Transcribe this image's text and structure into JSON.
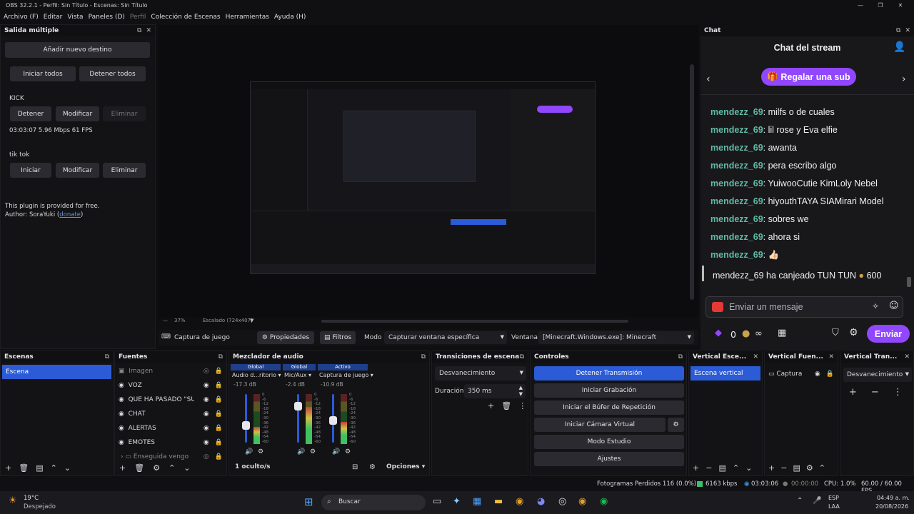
{
  "window": {
    "title": "OBS 32.2.1 - Perfil: Sin Título - Escenas: Sin Título"
  },
  "menu": [
    "Archivo (F)",
    "Editar",
    "Vista",
    "Paneles (D)",
    "Perfil",
    "Colección de Escenas",
    "Herramientas",
    "Ayuda (H)"
  ],
  "multi": {
    "title": "Salida múltiple",
    "add": "Añadir nuevo destino",
    "start_all": "Iniciar todos",
    "stop_all": "Detener todos",
    "kick": {
      "name": "KICK",
      "stop": "Detener",
      "edit": "Modificar",
      "del": "Eliminar",
      "stats": "03:03:07  5.96 Mbps  61 FPS"
    },
    "tiktok": {
      "name": "tik tok",
      "start": "Iniciar",
      "edit": "Modificar",
      "del": "Eliminar"
    },
    "plugin": "This plugin is provided for free.",
    "author_prefix": "Author: SoraYuki (",
    "donate": "donate",
    "author_suffix": ")"
  },
  "preview": {
    "zoom": "37%",
    "scaled": "Escalado (724x407)"
  },
  "ctxbar": {
    "source": "Captura de juego",
    "props": "Propiedades",
    "filters": "Filtros",
    "mode_label": "Modo",
    "mode": "Capturar ventana específica",
    "window_label": "Ventana",
    "window": "[Minecraft.Windows.exe]: Minecraft"
  },
  "chat": {
    "panel": "Chat",
    "title": "Chat del stream",
    "gift": "Regalar una sub",
    "messages": [
      {
        "user": "mendezz_69",
        "text": ": milfs o de cuales"
      },
      {
        "user": "mendezz_69",
        "text": ": lil rose y Eva elfie"
      },
      {
        "user": "mendezz_69",
        "text": ": awanta"
      },
      {
        "user": "mendezz_69",
        "text": ": pera escribo algo"
      },
      {
        "user": "mendezz_69",
        "text": ": YuiwooCutie KimLoly Nebel"
      },
      {
        "user": "mendezz_69",
        "text": ": hiyouthTAYA SIAMirari Model"
      },
      {
        "user": "mendezz_69",
        "text": ": sobres we"
      },
      {
        "user": "mendezz_69",
        "text": ": ahora si"
      },
      {
        "user": "mendezz_69",
        "text": ": 👍🏻"
      }
    ],
    "redeem": "mendezz_69 ha canjeado TUN TUN",
    "redeem_cost": "600",
    "placeholder": "Enviar un mensaje",
    "points": "0",
    "send": "Enviar"
  },
  "scenes": {
    "title": "Escenas",
    "items": [
      "Escena"
    ]
  },
  "sources": {
    "title": "Fuentes",
    "items": [
      "Imagen",
      "VOZ",
      "QUE HA PASADO \"SUB",
      "CHAT",
      "ALERTAS",
      "EMOTES",
      "Enseguida vengo"
    ]
  },
  "mixer": {
    "title": "Mezclador de audio",
    "channels": [
      {
        "badge": "Global",
        "name": "Audio d...ritorio",
        "db": "-17.3 dB",
        "level": 0.35
      },
      {
        "badge": "Global",
        "name": "Mic/Aux",
        "db": "-2.4 dB",
        "level": 0.75
      },
      {
        "badge": "Activo",
        "name": "Captura de juego",
        "db": "-10.9 dB",
        "level": 0.45
      }
    ],
    "scale": [
      "0",
      "-6",
      "-12",
      "-18",
      "-24",
      "-30",
      "-36",
      "-42",
      "-48",
      "-54",
      "-60"
    ],
    "hidden": "1 oculto/s",
    "options": "Opciones"
  },
  "transitions": {
    "title": "Transiciones de escena",
    "type": "Desvanecimiento",
    "dur_label": "Duración",
    "dur": "350 ms"
  },
  "controls": {
    "title": "Controles",
    "buttons": [
      "Detener Transmisión",
      "Iniciar Grabación",
      "Iniciar el Búfer de Repetición",
      "Iniciar Cámara Virtual",
      "Modo Estudio",
      "Ajustes"
    ]
  },
  "vscenes": {
    "title": "Vertical Esce...",
    "item": "Escena vertical"
  },
  "vsources": {
    "title": "Vertical Fuen...",
    "item": "Captura"
  },
  "vtrans": {
    "title": "Vertical Tran...",
    "type": "Desvanecimiento"
  },
  "status": {
    "dropped": "Fotogramas Perdidos 116 (0.0%)",
    "kbps": "6163 kbps",
    "time": "03:03:06",
    "rec": "00:00:00",
    "cpu": "CPU: 1.0%",
    "fps": "60.00 / 60.00 FPS"
  },
  "taskbar": {
    "temp": "19°C",
    "weather": "Despejado",
    "search": "Buscar",
    "lang1": "ESP",
    "lang2": "LAA",
    "clock": "04:49 a. m.",
    "date": "20/08/2026"
  },
  "colors": {
    "accent_blue": "#2b5bd6",
    "twitch_purple": "#9147ff",
    "username": "#5fb9a6"
  }
}
